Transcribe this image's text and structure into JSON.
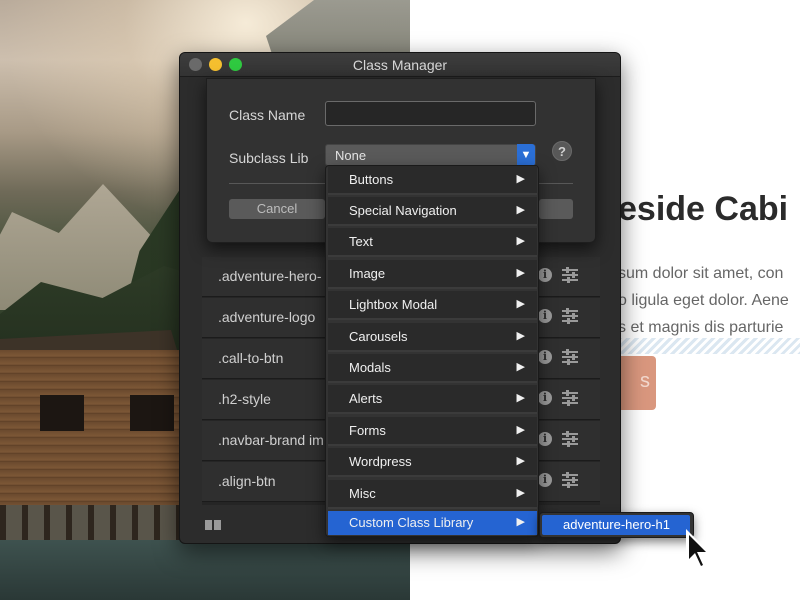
{
  "website": {
    "heading": "eside Cabi",
    "paragraph_lines": [
      "sum dolor sit amet, con",
      "o ligula eget dolor. Aene",
      "s et magnis dis parturie"
    ],
    "button_text": "s"
  },
  "window": {
    "title": "Class Manager",
    "class_rows": [
      ".adventure-hero-",
      ".adventure-logo",
      ".call-to-btn",
      ".h2-style",
      ".navbar-brand im",
      ".align-btn"
    ]
  },
  "sheet": {
    "class_name_label": "Class Name",
    "class_name_value": "",
    "subclass_label": "Subclass Lib",
    "subclass_value": "None",
    "help_label": "?",
    "cancel_label": "Cancel"
  },
  "menu": {
    "items": [
      "Buttons",
      "Special Navigation",
      "Text",
      "Image",
      "Lightbox Modal",
      "Carousels",
      "Modals",
      "Alerts",
      "Forms",
      "Wordpress",
      "Misc",
      "Custom Class Library"
    ],
    "active_index": 11,
    "submenu_arrow": "▶"
  },
  "submenu": {
    "items": [
      "adventure-hero-h1"
    ]
  },
  "colors": {
    "accent": "#2564d2",
    "traffic_min": "#f5bf2f",
    "traffic_max": "#2fc940"
  }
}
